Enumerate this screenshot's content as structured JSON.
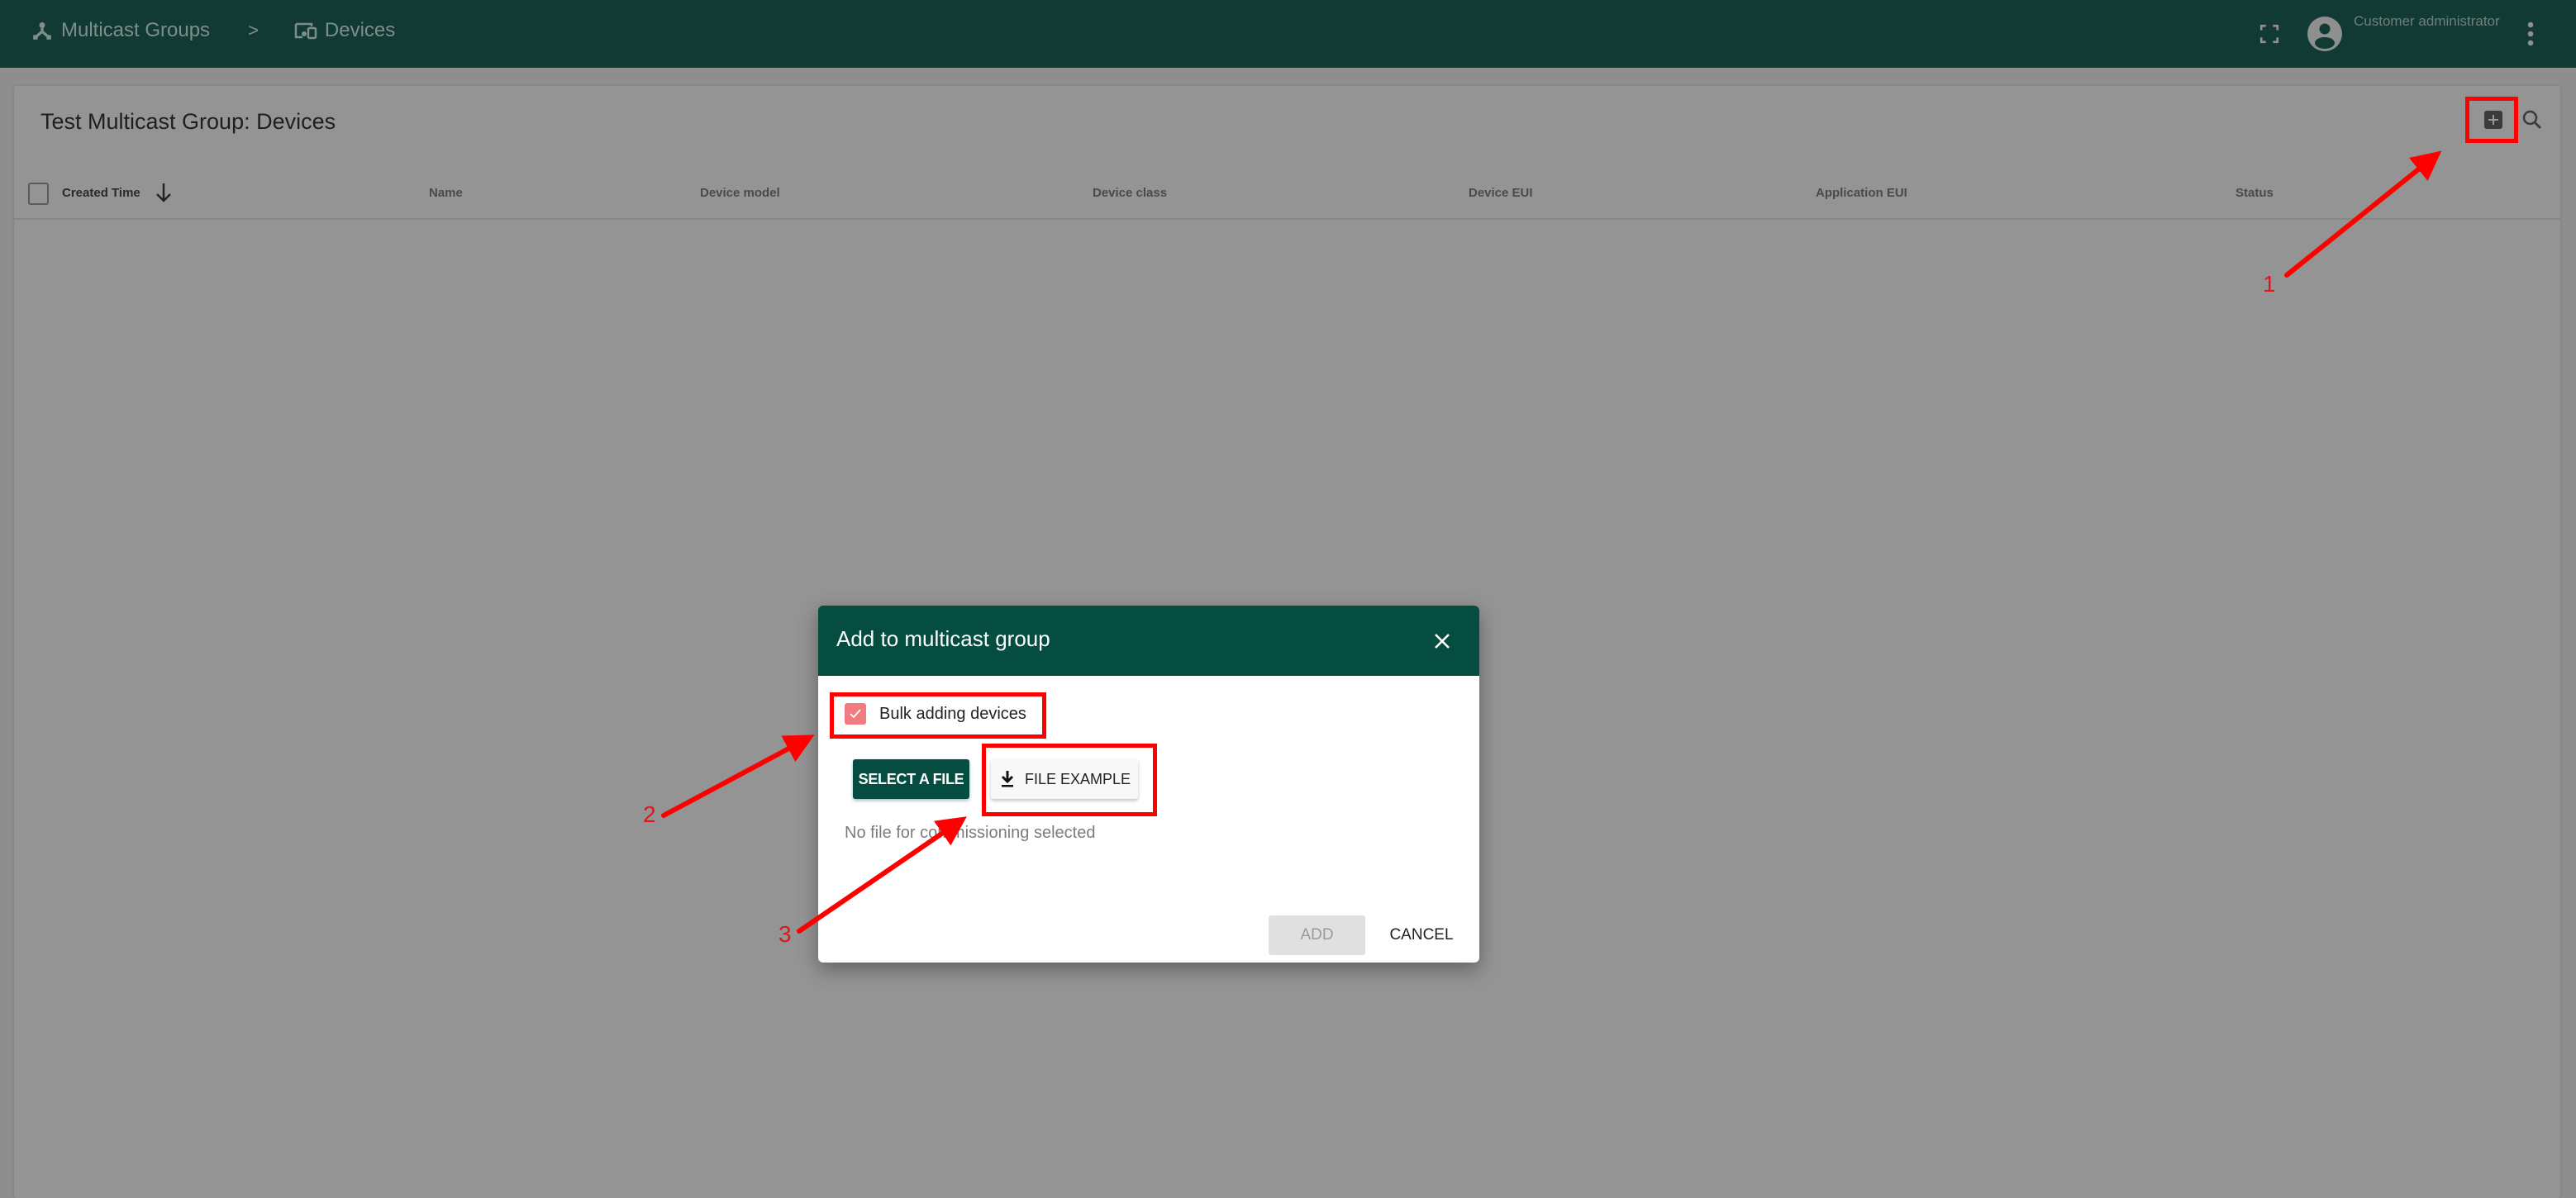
{
  "topbar": {
    "breadcrumb": [
      {
        "label": "Multicast Groups",
        "icon": "multicast-icon"
      },
      {
        "label": "Devices",
        "icon": "devices-icon"
      }
    ],
    "separator": ">",
    "user_role": "Customer administrator",
    "icons": [
      "fullscreen-icon",
      "account-circle-icon",
      "more-vert-icon"
    ]
  },
  "card": {
    "title": "Test Multicast Group: Devices",
    "actions": [
      "add-box-icon",
      "search-icon"
    ],
    "table": {
      "columns": [
        "Created Time",
        "Name",
        "Device model",
        "Device class",
        "Device EUI",
        "Application EUI",
        "Status"
      ],
      "sort_column": "Created Time",
      "sort_direction": "descending",
      "rows": []
    }
  },
  "dialog": {
    "title": "Add to multicast group",
    "bulk_label": "Bulk adding devices",
    "bulk_checked": true,
    "select_file_label": "SELECT A FILE",
    "file_example_label": "FILE EXAMPLE",
    "no_file_text": "No file for commissioning selected",
    "add_label": "ADD",
    "add_disabled": true,
    "cancel_label": "CANCEL"
  },
  "annotations": {
    "labels": [
      "1",
      "2",
      "3"
    ],
    "color": "#ff0000"
  },
  "colors": {
    "topbar": "#103a33",
    "dialog_header": "#044d40",
    "checkbox": "#f07c82"
  }
}
